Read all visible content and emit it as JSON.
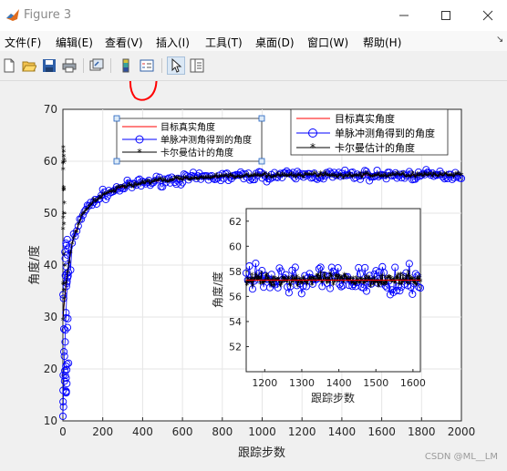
{
  "window": {
    "title": "Figure 3",
    "minimize_icon": "minimize-icon",
    "maximize_icon": "maximize-icon",
    "close_icon": "close-icon"
  },
  "menu": {
    "items": [
      "文件(F)",
      "编辑(E)",
      "查看(V)",
      "插入(I)",
      "工具(T)",
      "桌面(D)",
      "窗口(W)",
      "帮助(H)"
    ],
    "more_arrow": "↘"
  },
  "toolbar": {
    "icons": [
      "new-figure-icon",
      "open-file-icon",
      "save-icon",
      "print-icon",
      "link-plot-icon",
      "insert-colorbar-icon",
      "insert-legend-icon",
      "edit-plot-arrow-icon",
      "open-property-inspector-icon"
    ]
  },
  "colors": {
    "true_angle": "#ff0000",
    "monopulse": "#0000ff",
    "kalman": "#000000",
    "annotation": "#ff0000"
  },
  "chart_data": [
    {
      "type": "line",
      "xlabel": "跟踪步数",
      "ylabel": "角度/度",
      "xlim": [
        0,
        2000
      ],
      "ylim": [
        10,
        70
      ],
      "xticks": [
        "0",
        "200",
        "400",
        "600",
        "800",
        "1000",
        "1200",
        "1400",
        "1600",
        "1800",
        "2000"
      ],
      "yticks": [
        "10",
        "20",
        "30",
        "40",
        "50",
        "60",
        "70"
      ],
      "grid": true,
      "legend_placement": "top-right",
      "series": [
        {
          "name": "目标真实角度",
          "x": [
            0,
            20,
            50,
            100,
            150,
            200,
            300,
            400,
            500,
            600,
            800,
            1000,
            1200,
            1400,
            1600,
            1800,
            2000
          ],
          "values": [
            30,
            38,
            45,
            50,
            52,
            53.5,
            55,
            55.8,
            56.3,
            56.6,
            57,
            57.2,
            57.3,
            57.3,
            57.3,
            57.3,
            57.3
          ]
        },
        {
          "name": "单脉冲测角得到的角度",
          "x": [
            0,
            20,
            50,
            100,
            150,
            200,
            300,
            400,
            500,
            600,
            800,
            1000,
            1200,
            1400,
            1600,
            1800,
            2000
          ],
          "values": [
            11,
            37,
            45,
            50,
            52,
            53.5,
            55,
            55.8,
            56.3,
            56.6,
            57,
            57.2,
            57.3,
            57.3,
            57.3,
            57.3,
            57.3
          ]
        },
        {
          "name": "卡尔曼估计的角度",
          "x": [
            0,
            20,
            50,
            100,
            150,
            200,
            300,
            400,
            500,
            600,
            800,
            1000,
            1200,
            1400,
            1600,
            1800,
            2000
          ],
          "values": [
            64,
            38,
            45,
            50,
            52,
            53.5,
            55,
            55.8,
            56.3,
            56.6,
            57,
            57.2,
            57.3,
            57.3,
            57.3,
            57.3,
            57.3
          ]
        }
      ],
      "legends": [
        {
          "entries": [
            "目标真实角度",
            "单脉冲测角得到的角度",
            "卡尔曼估计的角度"
          ],
          "selected": true
        },
        {
          "entries": [
            "目标真实角度",
            "单脉冲测角得到的角度",
            "卡尔曼估计的角度"
          ],
          "selected": false
        }
      ]
    },
    {
      "type": "line",
      "xlabel": "跟踪步数",
      "ylabel": "角度/度",
      "xlim": [
        1150,
        1620
      ],
      "ylim": [
        50,
        63
      ],
      "xticks": [
        "1200",
        "1300",
        "1400",
        "1500",
        "1600"
      ],
      "yticks": [
        "52",
        "54",
        "56",
        "58",
        "60",
        "62"
      ],
      "grid": false,
      "series": [
        {
          "name": "目标真实角度",
          "x": [
            1150,
            1620
          ],
          "values": [
            57.3,
            57.3
          ]
        },
        {
          "name": "单脉冲测角得到的角度",
          "x": [
            1150,
            1200,
            1250,
            1300,
            1350,
            1400,
            1450,
            1500,
            1550,
            1600,
            1620
          ],
          "values": [
            57.3,
            57.5,
            57.1,
            57.6,
            57.2,
            57.0,
            57.4,
            57.2,
            57.3,
            57.1,
            57.4
          ]
        },
        {
          "name": "卡尔曼估计的角度",
          "x": [
            1150,
            1200,
            1250,
            1300,
            1350,
            1400,
            1450,
            1500,
            1550,
            1600,
            1620
          ],
          "values": [
            57.2,
            57.4,
            57.3,
            57.5,
            57.2,
            57.2,
            57.3,
            57.2,
            57.3,
            57.2,
            57.3
          ]
        }
      ]
    }
  ],
  "watermark": "CSDN @ML__LM"
}
